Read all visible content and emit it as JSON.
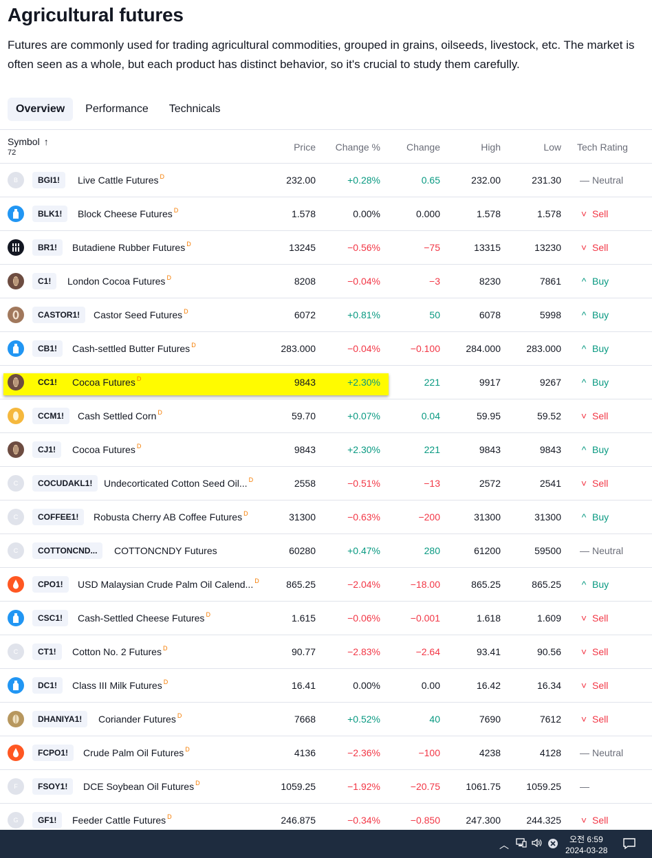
{
  "header": {
    "title": "Agricultural futures",
    "description": "Futures are commonly used for trading agricultural commodities, grouped in grains, oilseeds, livestock, etc. The market is often seen as a whole, but each product has distinct behavior, so it's crucial to study them carefully."
  },
  "tabs": [
    {
      "label": "Overview"
    },
    {
      "label": "Performance"
    },
    {
      "label": "Technicals"
    }
  ],
  "columns": {
    "symbol": "Symbol",
    "count": "72",
    "price": "Price",
    "change_pct": "Change %",
    "change": "Change",
    "high": "High",
    "low": "Low",
    "rating": "Tech Rating"
  },
  "rows": [
    {
      "icon": "letter",
      "letter": "B",
      "ticker": "BGI1!",
      "name": "Live Cattle Futures",
      "sup": "D",
      "price": "232.00",
      "change_pct": "+0.28%",
      "change": "0.65",
      "high": "232.00",
      "low": "231.30",
      "rating": "Neutral",
      "dir": "pos"
    },
    {
      "icon": "milk",
      "letter": "",
      "ticker": "BLK1!",
      "name": "Block Cheese Futures",
      "sup": "D",
      "price": "1.578",
      "change_pct": "0.00%",
      "change": "0.000",
      "high": "1.578",
      "low": "1.578",
      "rating": "Sell",
      "dir": "neu"
    },
    {
      "icon": "black",
      "letter": "",
      "ticker": "BR1!",
      "name": "Butadiene Rubber Futures",
      "sup": "D",
      "price": "13245",
      "change_pct": "−0.56%",
      "change": "−75",
      "high": "13315",
      "low": "13230",
      "rating": "Sell",
      "dir": "neg"
    },
    {
      "icon": "cocoa",
      "letter": "",
      "ticker": "C1!",
      "name": "London Cocoa Futures",
      "sup": "D",
      "price": "8208",
      "change_pct": "−0.04%",
      "change": "−3",
      "high": "8230",
      "low": "7861",
      "rating": "Buy",
      "dir": "neg"
    },
    {
      "icon": "castor",
      "letter": "",
      "ticker": "CASTOR1!",
      "name": "Castor Seed Futures",
      "sup": "D",
      "price": "6072",
      "change_pct": "+0.81%",
      "change": "50",
      "high": "6078",
      "low": "5998",
      "rating": "Buy",
      "dir": "pos"
    },
    {
      "icon": "milk",
      "letter": "",
      "ticker": "CB1!",
      "name": "Cash-settled Butter Futures",
      "sup": "D",
      "price": "283.000",
      "change_pct": "−0.04%",
      "change": "−0.100",
      "high": "284.000",
      "low": "283.000",
      "rating": "Buy",
      "dir": "neg"
    },
    {
      "icon": "cocoa",
      "letter": "",
      "ticker": "CC1!",
      "name": "Cocoa Futures",
      "sup": "D",
      "price": "9843",
      "change_pct": "+2.30%",
      "change": "221",
      "high": "9917",
      "low": "9267",
      "rating": "Buy",
      "dir": "pos"
    },
    {
      "icon": "corn",
      "letter": "",
      "ticker": "CCM1!",
      "name": "Cash Settled Corn",
      "sup": "D",
      "price": "59.70",
      "change_pct": "+0.07%",
      "change": "0.04",
      "high": "59.95",
      "low": "59.52",
      "rating": "Sell",
      "dir": "pos"
    },
    {
      "icon": "cocoa",
      "letter": "",
      "ticker": "CJ1!",
      "name": "Cocoa Futures",
      "sup": "D",
      "price": "9843",
      "change_pct": "+2.30%",
      "change": "221",
      "high": "9843",
      "low": "9843",
      "rating": "Buy",
      "dir": "pos"
    },
    {
      "icon": "letter",
      "letter": "C",
      "ticker": "COCUDAKL1!",
      "name": "Undecorticated Cotton Seed Oil...",
      "sup": "D",
      "price": "2558",
      "change_pct": "−0.51%",
      "change": "−13",
      "high": "2572",
      "low": "2541",
      "rating": "Sell",
      "dir": "neg"
    },
    {
      "icon": "letter",
      "letter": "C",
      "ticker": "COFFEE1!",
      "name": "Robusta Cherry AB Coffee Futures",
      "sup": "D",
      "price": "31300",
      "change_pct": "−0.63%",
      "change": "−200",
      "high": "31300",
      "low": "31300",
      "rating": "Buy",
      "dir": "neg"
    },
    {
      "icon": "letter",
      "letter": "C",
      "ticker": "COTTONCND...",
      "name": "COTTONCNDY Futures",
      "sup": "",
      "price": "60280",
      "change_pct": "+0.47%",
      "change": "280",
      "high": "61200",
      "low": "59500",
      "rating": "Neutral",
      "dir": "pos"
    },
    {
      "icon": "palm",
      "letter": "",
      "ticker": "CPO1!",
      "name": "USD Malaysian Crude Palm Oil Calend...",
      "sup": "D",
      "price": "865.25",
      "change_pct": "−2.04%",
      "change": "−18.00",
      "high": "865.25",
      "low": "865.25",
      "rating": "Buy",
      "dir": "neg"
    },
    {
      "icon": "milk",
      "letter": "",
      "ticker": "CSC1!",
      "name": "Cash-Settled Cheese Futures",
      "sup": "D",
      "price": "1.615",
      "change_pct": "−0.06%",
      "change": "−0.001",
      "high": "1.618",
      "low": "1.609",
      "rating": "Sell",
      "dir": "neg"
    },
    {
      "icon": "letter",
      "letter": "C",
      "ticker": "CT1!",
      "name": "Cotton No. 2 Futures",
      "sup": "D",
      "price": "90.77",
      "change_pct": "−2.83%",
      "change": "−2.64",
      "high": "93.41",
      "low": "90.56",
      "rating": "Sell",
      "dir": "neg"
    },
    {
      "icon": "milk",
      "letter": "",
      "ticker": "DC1!",
      "name": "Class III Milk Futures",
      "sup": "D",
      "price": "16.41",
      "change_pct": "0.00%",
      "change": "0.00",
      "high": "16.42",
      "low": "16.34",
      "rating": "Sell",
      "dir": "neu"
    },
    {
      "icon": "seed",
      "letter": "",
      "ticker": "DHANIYA1!",
      "name": "Coriander Futures",
      "sup": "D",
      "price": "7668",
      "change_pct": "+0.52%",
      "change": "40",
      "high": "7690",
      "low": "7612",
      "rating": "Sell",
      "dir": "pos"
    },
    {
      "icon": "palm",
      "letter": "",
      "ticker": "FCPO1!",
      "name": "Crude Palm Oil Futures",
      "sup": "D",
      "price": "4136",
      "change_pct": "−2.36%",
      "change": "−100",
      "high": "4238",
      "low": "4128",
      "rating": "Neutral",
      "dir": "neg"
    },
    {
      "icon": "letter",
      "letter": "F",
      "ticker": "FSOY1!",
      "name": "DCE Soybean Oil Futures",
      "sup": "D",
      "price": "1059.25",
      "change_pct": "−1.92%",
      "change": "−20.75",
      "high": "1061.75",
      "low": "1059.25",
      "rating": "",
      "dir": "neg"
    },
    {
      "icon": "letter",
      "letter": "G",
      "ticker": "GF1!",
      "name": "Feeder Cattle Futures",
      "sup": "D",
      "price": "246.875",
      "change_pct": "−0.34%",
      "change": "−0.850",
      "high": "247.300",
      "low": "244.325",
      "rating": "Sell",
      "dir": "neg"
    }
  ],
  "taskbar": {
    "time": "오전 6:59",
    "date": "2024-03-28"
  },
  "colors": {
    "positive": "#089981",
    "negative": "#f23645",
    "highlight": "#fffb00",
    "taskbar": "#1e2c3f"
  }
}
